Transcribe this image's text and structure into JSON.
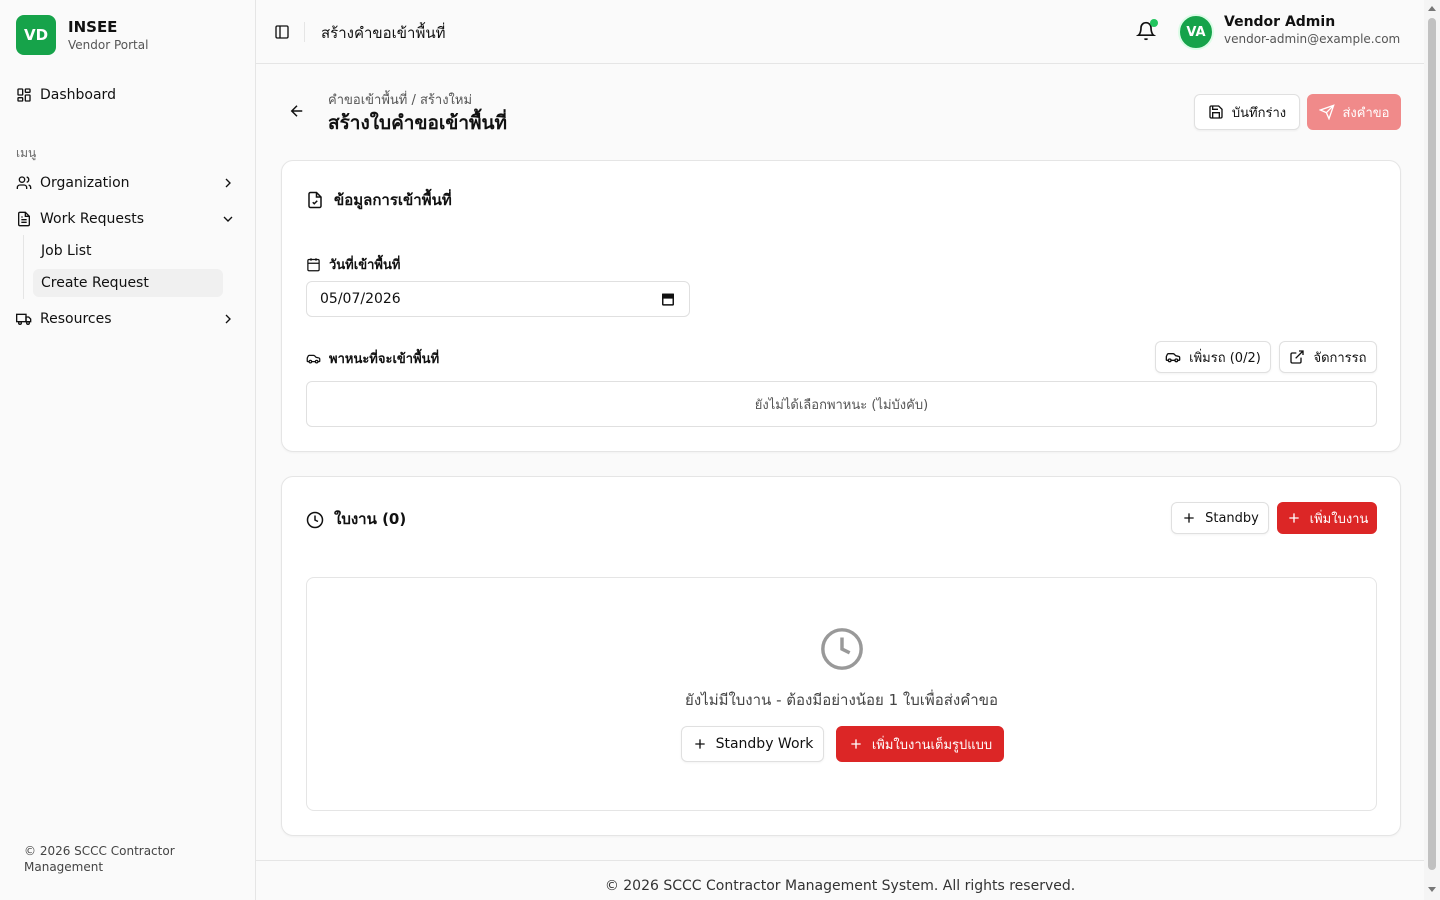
{
  "brand": {
    "logo": "VD",
    "name": "INSEE",
    "subtitle": "Vendor Portal"
  },
  "sidebar": {
    "dashboard": "Dashboard",
    "section_label": "เมนู",
    "organization": "Organization",
    "work_requests": "Work Requests",
    "job_list": "Job List",
    "create_request": "Create Request",
    "resources": "Resources",
    "footer": "© 2026 SCCC Contractor Management"
  },
  "header": {
    "title": "สร้างคำขอเข้าพื้นที่",
    "user_initials": "VA",
    "user_name": "Vendor Admin",
    "user_email": "vendor-admin@example.com"
  },
  "page": {
    "breadcrumb": "คำขอเข้าพื้นที่ / สร้างใหม่",
    "title": "สร้างใบคำขอเข้าพื้นที่",
    "save_draft": "บันทึกร่าง",
    "submit": "ส่งคำขอ"
  },
  "entry_card": {
    "title": "ข้อมูลการเข้าพื้นที่",
    "date_label": "วันที่เข้าพื้นที่",
    "date_value": "05/07/2026",
    "vehicle_label": "พาหนะที่จะเข้าพื้นที่",
    "add_vehicle": "เพิ่มรถ (0/2)",
    "manage_vehicle": "จัดการรถ",
    "vehicle_empty": "ยังไม่ได้เลือกพาหนะ (ไม่บังคับ)"
  },
  "work_card": {
    "title": "ใบงาน (0)",
    "standby": "Standby",
    "add_work": "เพิ่มใบงาน",
    "empty_text": "ยังไม่มีใบงาน - ต้องมีอย่างน้อย 1 ใบเพื่อส่งคำขอ",
    "standby_work": "Standby Work",
    "add_full_work": "เพิ่มใบงานเต็มรูปแบบ"
  },
  "footer": "© 2026 SCCC Contractor Management System. All rights reserved.",
  "colors": {
    "brand": "#16a34a",
    "accent": "#dc2626",
    "accent_disabled": "#f08a8a"
  }
}
